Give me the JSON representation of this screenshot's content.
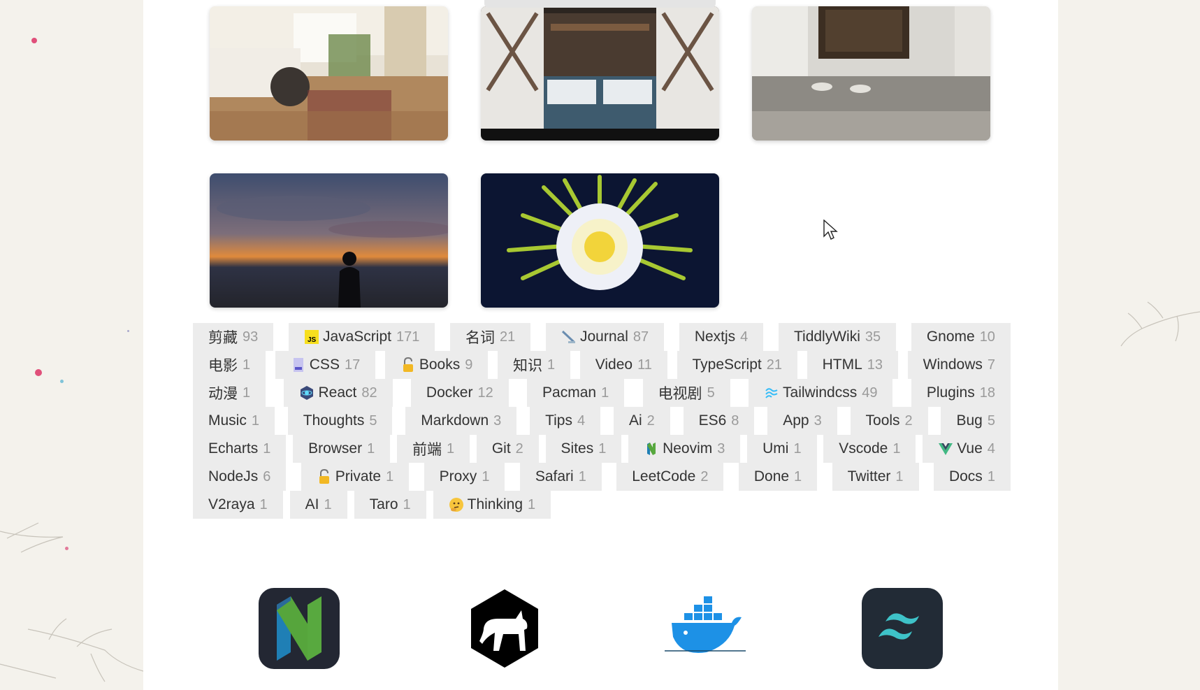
{
  "photos": [
    {
      "name": "bedroom-photo"
    },
    {
      "name": "cabin-bed-photo"
    },
    {
      "name": "doorway-photo"
    },
    {
      "name": "sunset-silhouette-photo"
    },
    {
      "name": "cactus-flower-photo"
    }
  ],
  "tag_rows": [
    [
      {
        "label": "剪藏",
        "count": "93",
        "icon": ""
      },
      {
        "label": "JavaScript",
        "count": "171",
        "icon": "js-icon"
      },
      {
        "label": "名词",
        "count": "21",
        "icon": ""
      },
      {
        "label": "Journal",
        "count": "87",
        "icon": "pen-icon"
      },
      {
        "label": "Nextjs",
        "count": "4",
        "icon": ""
      },
      {
        "label": "TiddlyWiki",
        "count": "35",
        "icon": ""
      },
      {
        "label": "Gnome",
        "count": "10",
        "icon": ""
      }
    ],
    [
      {
        "label": "电影",
        "count": "1",
        "icon": ""
      },
      {
        "label": "CSS",
        "count": "17",
        "icon": "css-icon"
      },
      {
        "label": "Books",
        "count": "9",
        "icon": "lock-icon"
      },
      {
        "label": "知识",
        "count": "1",
        "icon": ""
      },
      {
        "label": "Video",
        "count": "11",
        "icon": ""
      },
      {
        "label": "TypeScript",
        "count": "21",
        "icon": ""
      },
      {
        "label": "HTML",
        "count": "13",
        "icon": ""
      },
      {
        "label": "Windows",
        "count": "7",
        "icon": ""
      }
    ],
    [
      {
        "label": "动漫",
        "count": "1",
        "icon": ""
      },
      {
        "label": "React",
        "count": "82",
        "icon": "react-icon"
      },
      {
        "label": "Docker",
        "count": "12",
        "icon": ""
      },
      {
        "label": "Pacman",
        "count": "1",
        "icon": ""
      },
      {
        "label": "电视剧",
        "count": "5",
        "icon": ""
      },
      {
        "label": "Tailwindcss",
        "count": "49",
        "icon": "tailwind-icon"
      },
      {
        "label": "Plugins",
        "count": "18",
        "icon": ""
      }
    ],
    [
      {
        "label": "Music",
        "count": "1",
        "icon": ""
      },
      {
        "label": "Thoughts",
        "count": "5",
        "icon": ""
      },
      {
        "label": "Markdown",
        "count": "3",
        "icon": ""
      },
      {
        "label": "Tips",
        "count": "4",
        "icon": ""
      },
      {
        "label": "Ai",
        "count": "2",
        "icon": ""
      },
      {
        "label": "ES6",
        "count": "8",
        "icon": ""
      },
      {
        "label": "App",
        "count": "3",
        "icon": ""
      },
      {
        "label": "Tools",
        "count": "2",
        "icon": ""
      },
      {
        "label": "Bug",
        "count": "5",
        "icon": ""
      }
    ],
    [
      {
        "label": "Echarts",
        "count": "1",
        "icon": ""
      },
      {
        "label": "Browser",
        "count": "1",
        "icon": ""
      },
      {
        "label": "前端",
        "count": "1",
        "icon": ""
      },
      {
        "label": "Git",
        "count": "2",
        "icon": ""
      },
      {
        "label": "Sites",
        "count": "1",
        "icon": ""
      },
      {
        "label": "Neovim",
        "count": "3",
        "icon": "neovim-icon"
      },
      {
        "label": "Umi",
        "count": "1",
        "icon": ""
      },
      {
        "label": "Vscode",
        "count": "1",
        "icon": ""
      },
      {
        "label": "Vue",
        "count": "4",
        "icon": "vue-icon"
      }
    ],
    [
      {
        "label": "NodeJs",
        "count": "6",
        "icon": ""
      },
      {
        "label": "Private",
        "count": "1",
        "icon": "lock-icon"
      },
      {
        "label": "Proxy",
        "count": "1",
        "icon": ""
      },
      {
        "label": "Safari",
        "count": "1",
        "icon": ""
      },
      {
        "label": "LeetCode",
        "count": "2",
        "icon": ""
      },
      {
        "label": "Done",
        "count": "1",
        "icon": ""
      },
      {
        "label": "Twitter",
        "count": "1",
        "icon": ""
      },
      {
        "label": "Docs",
        "count": "1",
        "icon": ""
      }
    ],
    [
      {
        "label": "V2raya",
        "count": "1",
        "icon": ""
      },
      {
        "label": "AI",
        "count": "1",
        "icon": ""
      },
      {
        "label": "Taro",
        "count": "1",
        "icon": ""
      },
      {
        "label": "Thinking",
        "count": "1",
        "icon": "thinking-face-icon"
      }
    ]
  ],
  "app_icons": [
    "neovim-app-icon",
    "tiddlywiki-app-icon",
    "docker-app-icon",
    "tailwindcss-app-icon"
  ],
  "colors": {
    "page_bg": "#f4f2ec",
    "content_bg": "#ffffff",
    "tag_bg": "#ececec",
    "tag_text": "#333333",
    "tag_count": "#9a9a9a",
    "accent_dot": "#e0507a"
  }
}
